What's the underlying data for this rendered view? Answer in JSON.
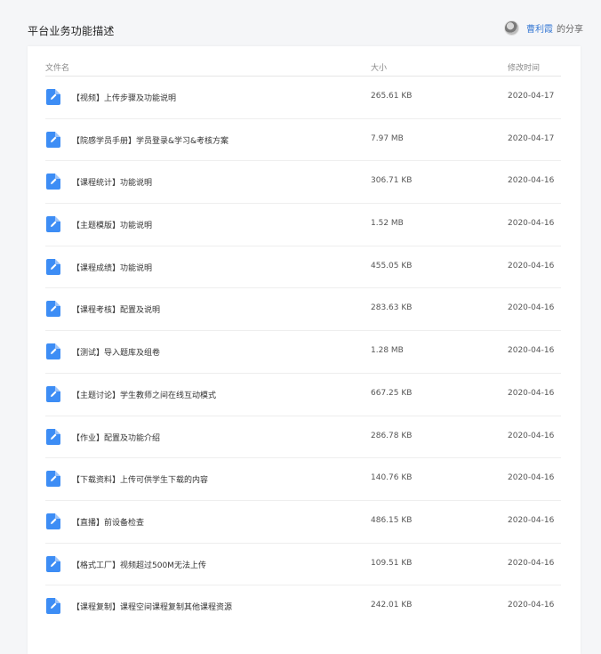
{
  "header": {
    "title": "平台业务功能描述",
    "owner_name": "曹利霞",
    "owner_suffix": "的分享"
  },
  "table": {
    "columns": {
      "name": "文件名",
      "size": "大小",
      "date": "修改时间"
    },
    "rows": [
      {
        "name": "【视频】上传步骤及功能说明",
        "size": "265.61 KB",
        "date": "2020-04-17"
      },
      {
        "name": "【院感学员手册】学员登录&学习&考核方案",
        "size": "7.97 MB",
        "date": "2020-04-17"
      },
      {
        "name": "【课程统计】功能说明",
        "size": "306.71 KB",
        "date": "2020-04-16"
      },
      {
        "name": "【主题模版】功能说明",
        "size": "1.52 MB",
        "date": "2020-04-16"
      },
      {
        "name": "【课程成绩】功能说明",
        "size": "455.05 KB",
        "date": "2020-04-16"
      },
      {
        "name": "【课程考核】配置及说明",
        "size": "283.63 KB",
        "date": "2020-04-16"
      },
      {
        "name": "【测试】导入题库及组卷",
        "size": "1.28 MB",
        "date": "2020-04-16"
      },
      {
        "name": "【主题讨论】学生教师之间在线互动模式",
        "size": "667.25 KB",
        "date": "2020-04-16"
      },
      {
        "name": "【作业】配置及功能介绍",
        "size": "286.78 KB",
        "date": "2020-04-16"
      },
      {
        "name": "【下载资料】上传可供学生下载的内容",
        "size": "140.76 KB",
        "date": "2020-04-16"
      },
      {
        "name": "【直播】前设备检查",
        "size": "486.15 KB",
        "date": "2020-04-16"
      },
      {
        "name": "【格式工厂】视频超过500M无法上传",
        "size": "109.51 KB",
        "date": "2020-04-16"
      },
      {
        "name": "【课程复制】课程空间课程复制其他课程资源",
        "size": "242.01 KB",
        "date": "2020-04-16"
      }
    ]
  },
  "colors": {
    "accent": "#3d8df5",
    "link": "#3a7bd5"
  },
  "icons": {
    "file": "document-edit-icon",
    "avatar": "user-avatar"
  }
}
